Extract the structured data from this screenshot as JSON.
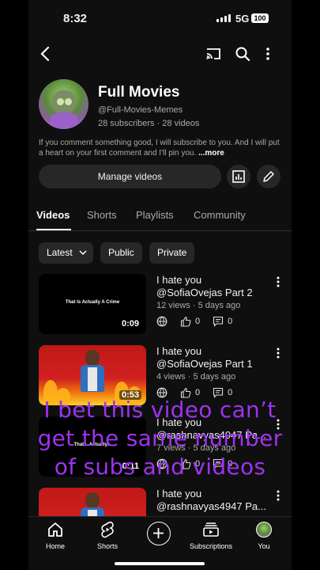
{
  "status_bar": {
    "time": "8:32",
    "network": "5G",
    "battery": "100"
  },
  "channel": {
    "name": "Full Movies",
    "handle": "@Full-Movies-Memes",
    "stats": "28 subscribers · 28 videos",
    "description": "If you comment something good, I will subscribe to you. And I will put a heart on your first comment and I'll pin you.",
    "more_label": "...more",
    "manage_label": "Manage videos"
  },
  "tabs": [
    {
      "label": "Videos",
      "active": true
    },
    {
      "label": "Shorts",
      "active": false
    },
    {
      "label": "Playlists",
      "active": false
    },
    {
      "label": "Community",
      "active": false
    }
  ],
  "filters": {
    "sort_label": "Latest",
    "public_label": "Public",
    "private_label": "Private"
  },
  "videos": [
    {
      "title_line1": "I hate you",
      "title_line2": "@SofiaOvejas Part 2",
      "meta": "12 views · 5 days ago",
      "likes": "0",
      "comments": "0",
      "duration": "0:09",
      "thumb_text": "That Is Actually A Crime"
    },
    {
      "title_line1": "I hate you",
      "title_line2": "@SofiaOvejas Part 1",
      "meta": "4 views · 5 days ago",
      "likes": "0",
      "comments": "0",
      "duration": "0:53"
    },
    {
      "title_line1": "I hate you",
      "title_line2": "@rashnavyas4947 Pa...",
      "meta": "7 views · 5 days ago",
      "likes": "0",
      "comments": "0",
      "duration": "0:11",
      "thumb_text": "That... Actually..."
    },
    {
      "title_line1": "I hate you",
      "title_line2": "@rashnavyas4947 Pa..."
    }
  ],
  "overlay_caption": [
    "I bet this video can’t",
    "get the same number",
    "of subs and videos"
  ],
  "bottom_nav": {
    "home": "Home",
    "shorts": "Shorts",
    "subscriptions": "Subscriptions",
    "you": "You"
  },
  "colors": {
    "background": "#0f0f0f",
    "chip": "#272727",
    "overlay_text": "#9d33ee",
    "secondary_text": "#aaaaaa"
  }
}
